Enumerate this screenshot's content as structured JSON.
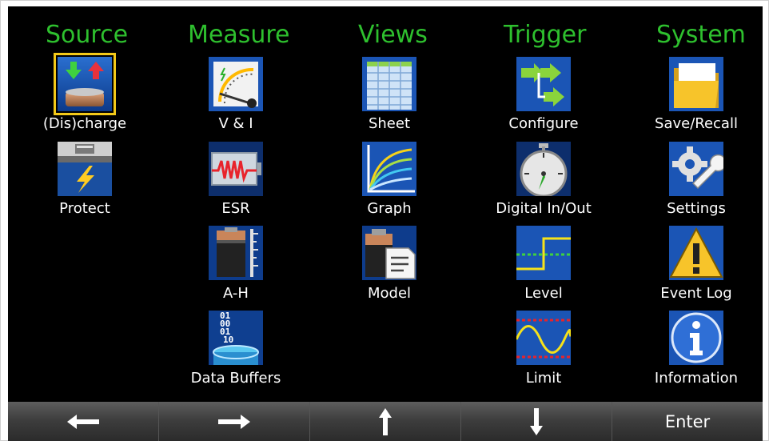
{
  "menu": {
    "columns": [
      {
        "header": "Source",
        "items": [
          {
            "label": "(Dis)charge",
            "icon": "battery-charge-icon",
            "selected": true
          },
          {
            "label": "Protect",
            "icon": "protect-lightning-icon"
          }
        ]
      },
      {
        "header": "Measure",
        "items": [
          {
            "label": "V & I",
            "icon": "meter-gauge-icon"
          },
          {
            "label": "ESR",
            "icon": "esr-waveform-icon"
          },
          {
            "label": "A-H",
            "icon": "amp-hour-battery-icon"
          },
          {
            "label": "Data Buffers",
            "icon": "data-buffer-icon"
          }
        ]
      },
      {
        "header": "Views",
        "items": [
          {
            "label": "Sheet",
            "icon": "sheet-grid-icon"
          },
          {
            "label": "Graph",
            "icon": "graph-curves-icon"
          },
          {
            "label": "Model",
            "icon": "battery-model-icon"
          }
        ]
      },
      {
        "header": "Trigger",
        "items": [
          {
            "label": "Configure",
            "icon": "flow-arrows-icon"
          },
          {
            "label": "Digital In/Out",
            "icon": "stopwatch-icon"
          },
          {
            "label": "Level",
            "icon": "level-step-icon"
          },
          {
            "label": "Limit",
            "icon": "limit-sine-icon"
          }
        ]
      },
      {
        "header": "System",
        "items": [
          {
            "label": "Save/Recall",
            "icon": "folder-icon"
          },
          {
            "label": "Settings",
            "icon": "gear-wrench-icon"
          },
          {
            "label": "Event Log",
            "icon": "warning-triangle-icon"
          },
          {
            "label": "Information",
            "icon": "info-icon"
          }
        ]
      }
    ]
  },
  "footer": {
    "left_icon": "arrow-left-icon",
    "right_icon": "arrow-right-icon",
    "up_icon": "arrow-up-icon",
    "down_icon": "arrow-down-icon",
    "enter_label": "Enter"
  },
  "colors": {
    "header": "#2ec02e",
    "background": "#000000",
    "selection": "#f3c919",
    "label": "#ffffff"
  }
}
